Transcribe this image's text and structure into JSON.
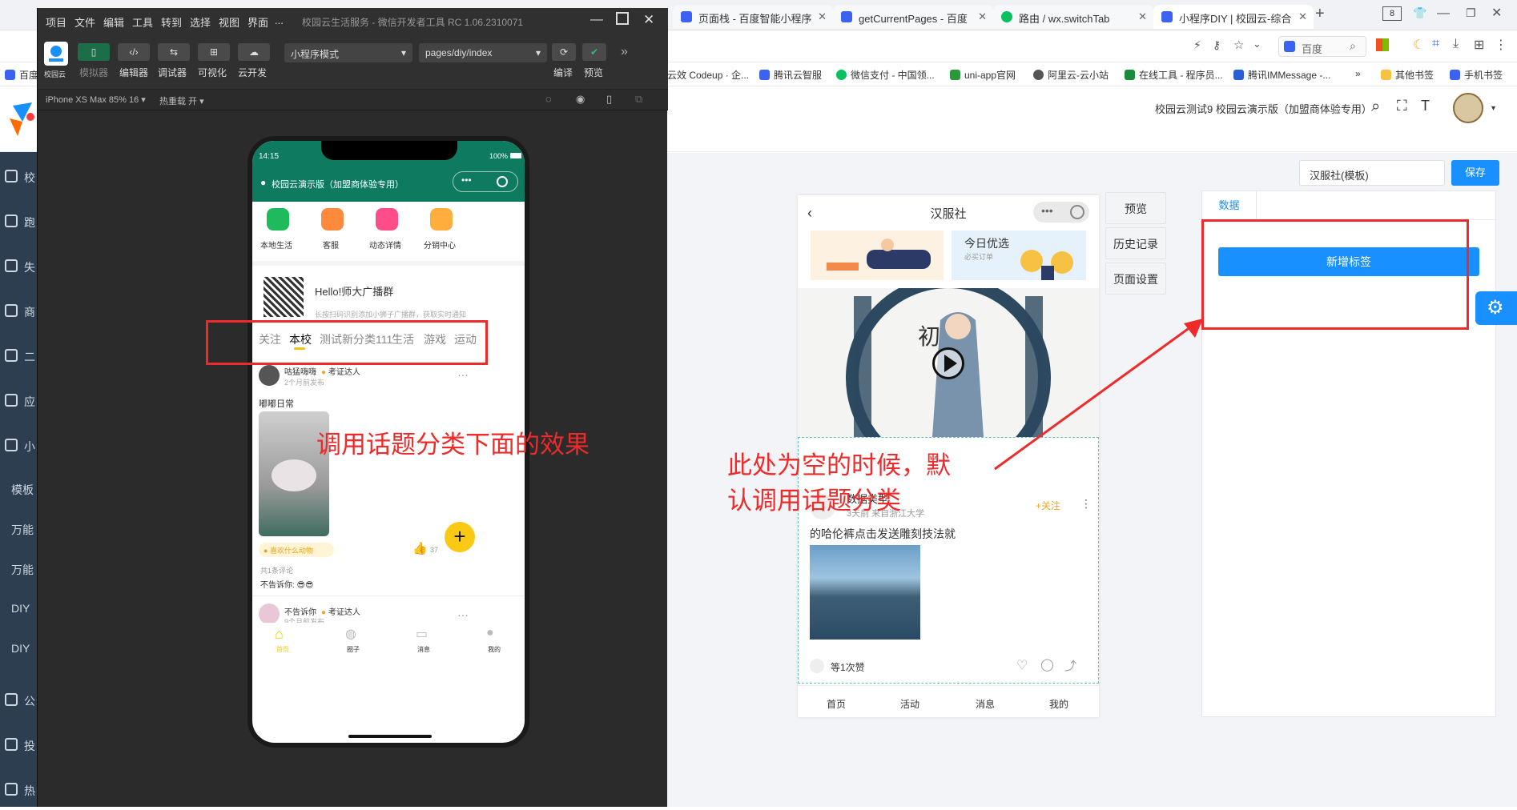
{
  "browser": {
    "tabs": [
      {
        "title": "页面栈 - 百度智能小程序",
        "color": "#3b62f0"
      },
      {
        "title": "getCurrentPages - 百度",
        "color": "#3b62f0"
      },
      {
        "title": "路由 / wx.switchTab",
        "color": "#07c160"
      },
      {
        "title": "小程序DIY | 校园云-综合",
        "color": "#3b62f0"
      }
    ],
    "tab_count": "8",
    "search_engine": "百度",
    "bookmarks_left": "百度一",
    "bookmarks": [
      "云效 Codeup · 企...",
      "腾讯云智服",
      "微信支付 - 中国领...",
      "uni-app官网",
      "阿里云-云小站",
      "在线工具 - 程序员...",
      "腾讯IMMessage -..."
    ],
    "bookmark_more": "»",
    "other_bookmarks": "其他书签",
    "mobile_bookmarks": "手机书签"
  },
  "devtools": {
    "menu": [
      "项目",
      "文件",
      "编辑",
      "工具",
      "转到",
      "选择",
      "视图",
      "界面",
      "..."
    ],
    "title": "校园云生活服务 - 微信开发者工具 RC 1.06.2310071",
    "logo_label": "校园云",
    "tool_labels": [
      "模拟器",
      "编辑器",
      "调试器",
      "可视化",
      "云开发"
    ],
    "mode_select": "小程序模式",
    "page_select": "pages/diy/index",
    "compile_label": "编译",
    "preview_label": "预览",
    "more": "»",
    "device": "iPhone XS Max 85% 16",
    "hot_reload": "热重载 开"
  },
  "phone": {
    "time": "14:15",
    "battery": "100%",
    "header_title": "校园云演示版（加盟商体验专用）",
    "quick_icons": [
      {
        "label": "本地生活",
        "color": "#1fba5c"
      },
      {
        "label": "客服",
        "color": "#ff8a3d"
      },
      {
        "label": "动态详情",
        "color": "#ff4d8a"
      },
      {
        "label": "分销中心",
        "color": "#ffae3d"
      }
    ],
    "group_title": "Hello!师大广播群",
    "group_sub": "长按扫码识别添加小狮子广播群，获取实时通知",
    "tabs": [
      "关注",
      "本校",
      "测试新分类111",
      "生活",
      "游戏",
      "运动"
    ],
    "active_tab": "本校",
    "post1": {
      "user": "咕猛嗨嗨",
      "badge": "考证达人",
      "time": "2个月前发布",
      "text": "嘟嘟日常",
      "topic": "喜欢什么动物",
      "likes": "37",
      "comments_count": "共1条评论",
      "comment": "不告诉你:"
    },
    "post2": {
      "user": "不告诉你",
      "badge": "考证达人",
      "time": "9个月前发布"
    },
    "nav": [
      "首页",
      "圈子",
      "消息",
      "我的"
    ]
  },
  "annotations": {
    "left": "调用话题分类下面的效果",
    "right_line1": "此处为空的时候，默",
    "right_line2": "认调用话题分类"
  },
  "admin": {
    "sidebar": [
      "校",
      "跑",
      "失",
      "商",
      "二",
      "应",
      "小"
    ],
    "sidebar_sub": [
      "模板",
      "万能",
      "万能",
      "DIY",
      "DIY"
    ],
    "sidebar_bottom": [
      "公",
      "投",
      "热"
    ],
    "header_user": "校园云测试9 校园云演示版（加盟商体验专用）",
    "template_name": "汉服社(模板)",
    "save": "保存"
  },
  "preview": {
    "title": "汉服社",
    "banner_text": "今日优选",
    "banner_sub": "必买订单",
    "post_user": "数据类型",
    "post_meta": "3天前 来自浙江大学",
    "follow": "+关注",
    "post_text": "的哈伦裤点击发送雕刻技法就",
    "likes_text": "等1次赞",
    "nav": [
      "首页",
      "活动",
      "消息",
      "我的"
    ]
  },
  "side_buttons": [
    "预览",
    "历史记录",
    "页面设置"
  ],
  "panel": {
    "tab": "数据",
    "add_button": "新增标签"
  }
}
